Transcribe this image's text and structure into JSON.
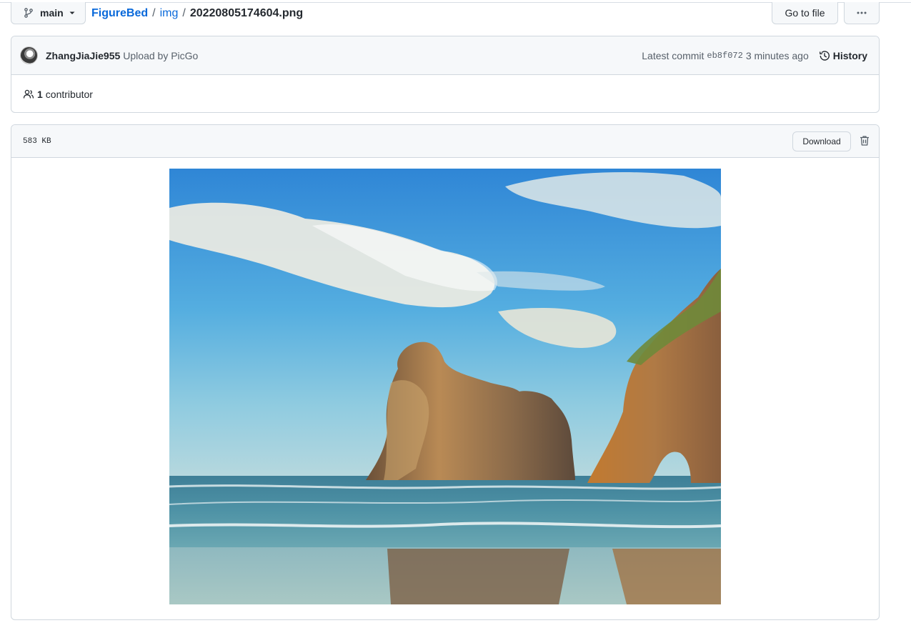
{
  "header": {
    "branch_label": "main",
    "breadcrumb": {
      "repo": "FigureBed",
      "folder": "img",
      "separator": "/",
      "file": "20220805174604.png"
    },
    "goto_label": "Go to file",
    "more_label": "···"
  },
  "commit": {
    "author": "ZhangJiaJie955",
    "message": "Upload by PicGo",
    "latest_label": "Latest commit",
    "sha": "eb8f072",
    "time": "3 minutes ago",
    "history_label": "History"
  },
  "contributors": {
    "count": "1",
    "label": "contributor"
  },
  "file": {
    "size": "583 KB",
    "download_label": "Download"
  },
  "icons": {
    "branch": "git-branch-icon",
    "caret": "triangle-down-icon",
    "history": "history-clock-icon",
    "people": "people-icon",
    "trash": "trash-icon"
  },
  "colors": {
    "link": "#0969da",
    "border": "#d0d7de",
    "header_bg": "#f6f8fa",
    "text": "#24292f",
    "muted": "#57606a"
  }
}
